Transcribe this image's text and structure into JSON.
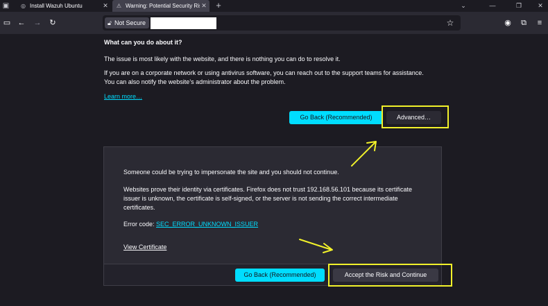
{
  "tabs": [
    {
      "title": "Install Wazuh Ubuntu",
      "icon": "globe-icon"
    },
    {
      "title": "Warning: Potential Security Risk Ahead",
      "icon": "warning-icon",
      "active": true
    }
  ],
  "toolbar": {
    "new_tab": "+",
    "not_secure_label": "Not Secure"
  },
  "page": {
    "heading": "What can you do about it?",
    "para1": "The issue is most likely with the website, and there is nothing you can do to resolve it.",
    "para2_line1": "If you are on a corporate network or using antivirus software, you can reach out to the support teams for assistance.",
    "para2_line2": "You can also notify the website’s administrator about the problem.",
    "learn_more": "Learn more…",
    "go_back_label": "Go Back (Recommended)",
    "advanced_label": "Advanced…"
  },
  "advanced": {
    "impersonate_text": "Someone could be trying to impersonate the site and you should not continue.",
    "cert_line1": "Websites prove their identity via certificates. Firefox does not trust 192.168.56.101 because its certificate",
    "cert_line2": "issuer is unknown, the certificate is self-signed, or the server is not sending the correct intermediate",
    "cert_line3": "certificates.",
    "error_code_label": "Error code: ",
    "error_code": "SEC_ERROR_UNKNOWN_ISSUER",
    "view_certificate": "View Certificate",
    "go_back_label": "Go Back (Recommended)",
    "accept_label": "Accept the Risk and Continue"
  },
  "colors": {
    "accent": "#00ddff",
    "highlight": "#f2f22a",
    "background": "#1c1b22",
    "panel": "#2b2a33"
  }
}
